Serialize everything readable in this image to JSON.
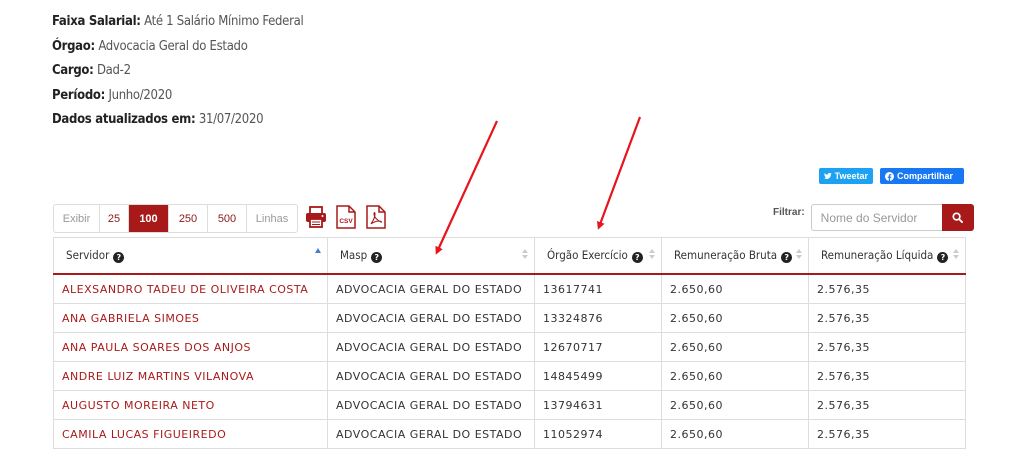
{
  "info": {
    "faixa_label": "Faixa Salarial:",
    "faixa_value": "Até 1 Salário Mínimo Federal",
    "orgao_label": "Órgao:",
    "orgao_value": "Advocacia Geral do Estado",
    "cargo_label": "Cargo:",
    "cargo_value": "Dad-2",
    "periodo_label": "Período:",
    "periodo_value": "Junho/2020",
    "dados_label": "Dados atualizados em:",
    "dados_value": "31/07/2020"
  },
  "social": {
    "tweet": "Tweetar",
    "share": "Compartilhar"
  },
  "pager": {
    "label": "Exibir",
    "options": [
      "25",
      "100",
      "250",
      "500"
    ],
    "selected": "100",
    "suffix": "Linhas"
  },
  "exports": {
    "print_icon": "printer-icon",
    "csv_icon": "csv-file-icon",
    "pdf_icon": "pdf-file-icon",
    "csv_text": "CSV"
  },
  "filter": {
    "label": "Filtrar:",
    "placeholder": "Nome do Servidor",
    "button_icon": "search-icon"
  },
  "table": {
    "columns": [
      "Servidor",
      "Masp",
      "Órgão Exercício",
      "Remuneração Bruta",
      "Remuneração Líquida"
    ],
    "sorted_column": "Servidor",
    "sort_direction": "ascending",
    "rows": [
      [
        "ALEXSANDRO TADEU DE OLIVEIRA COSTA",
        "ADVOCACIA GERAL DO ESTADO",
        "13617741",
        "2.650,60",
        "2.576,35"
      ],
      [
        "ANA GABRIELA SIMOES",
        "ADVOCACIA GERAL DO ESTADO",
        "13324876",
        "2.650,60",
        "2.576,35"
      ],
      [
        "ANA PAULA SOARES DOS ANJOS",
        "ADVOCACIA GERAL DO ESTADO",
        "12670717",
        "2.650,60",
        "2.576,35"
      ],
      [
        "ANDRE LUIZ MARTINS VILANOVA",
        "ADVOCACIA GERAL DO ESTADO",
        "14845499",
        "2.650,60",
        "2.576,35"
      ],
      [
        "AUGUSTO MOREIRA NETO",
        "ADVOCACIA GERAL DO ESTADO",
        "13794631",
        "2.650,60",
        "2.576,35"
      ],
      [
        "CAMILA LUCAS FIGUEIREDO",
        "ADVOCACIA GERAL DO ESTADO",
        "11052974",
        "2.650,60",
        "2.576,35"
      ]
    ]
  },
  "colors": {
    "accent": "#a81a1a",
    "twitter": "#1da1f2",
    "facebook": "#1877f2",
    "annotation_arrow": "#e8141c",
    "sort_active": "#4a7bd0"
  }
}
